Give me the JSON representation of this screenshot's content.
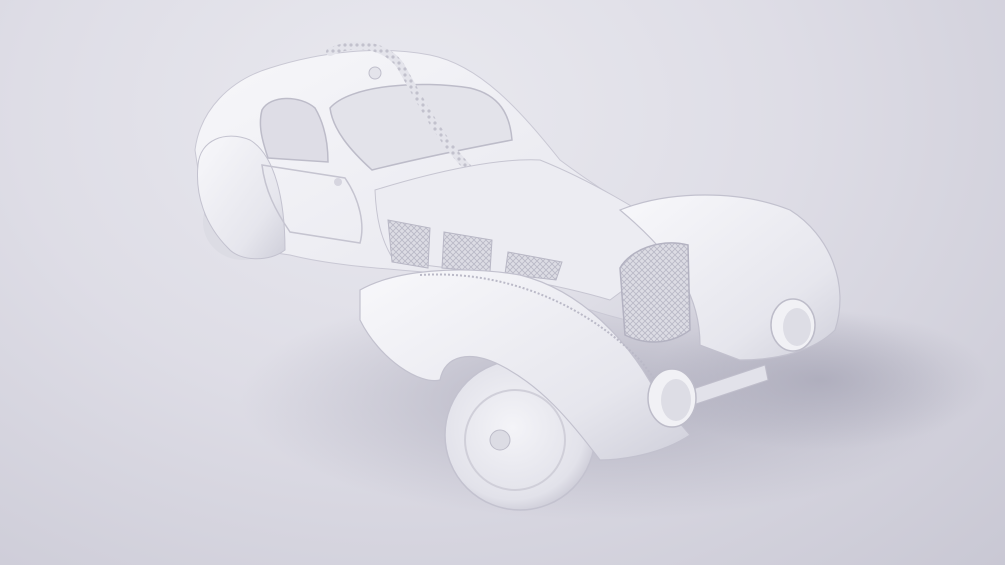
{
  "scene": {
    "subject": "car-clay-render",
    "colors": {
      "background_light": "#e9e9ef",
      "background_dark": "#c9c8d4",
      "body": "#f2f2f6",
      "body_shade": "#d4d3dd",
      "shadow": "#aeadbc",
      "grille": "#cfcfd8"
    }
  }
}
